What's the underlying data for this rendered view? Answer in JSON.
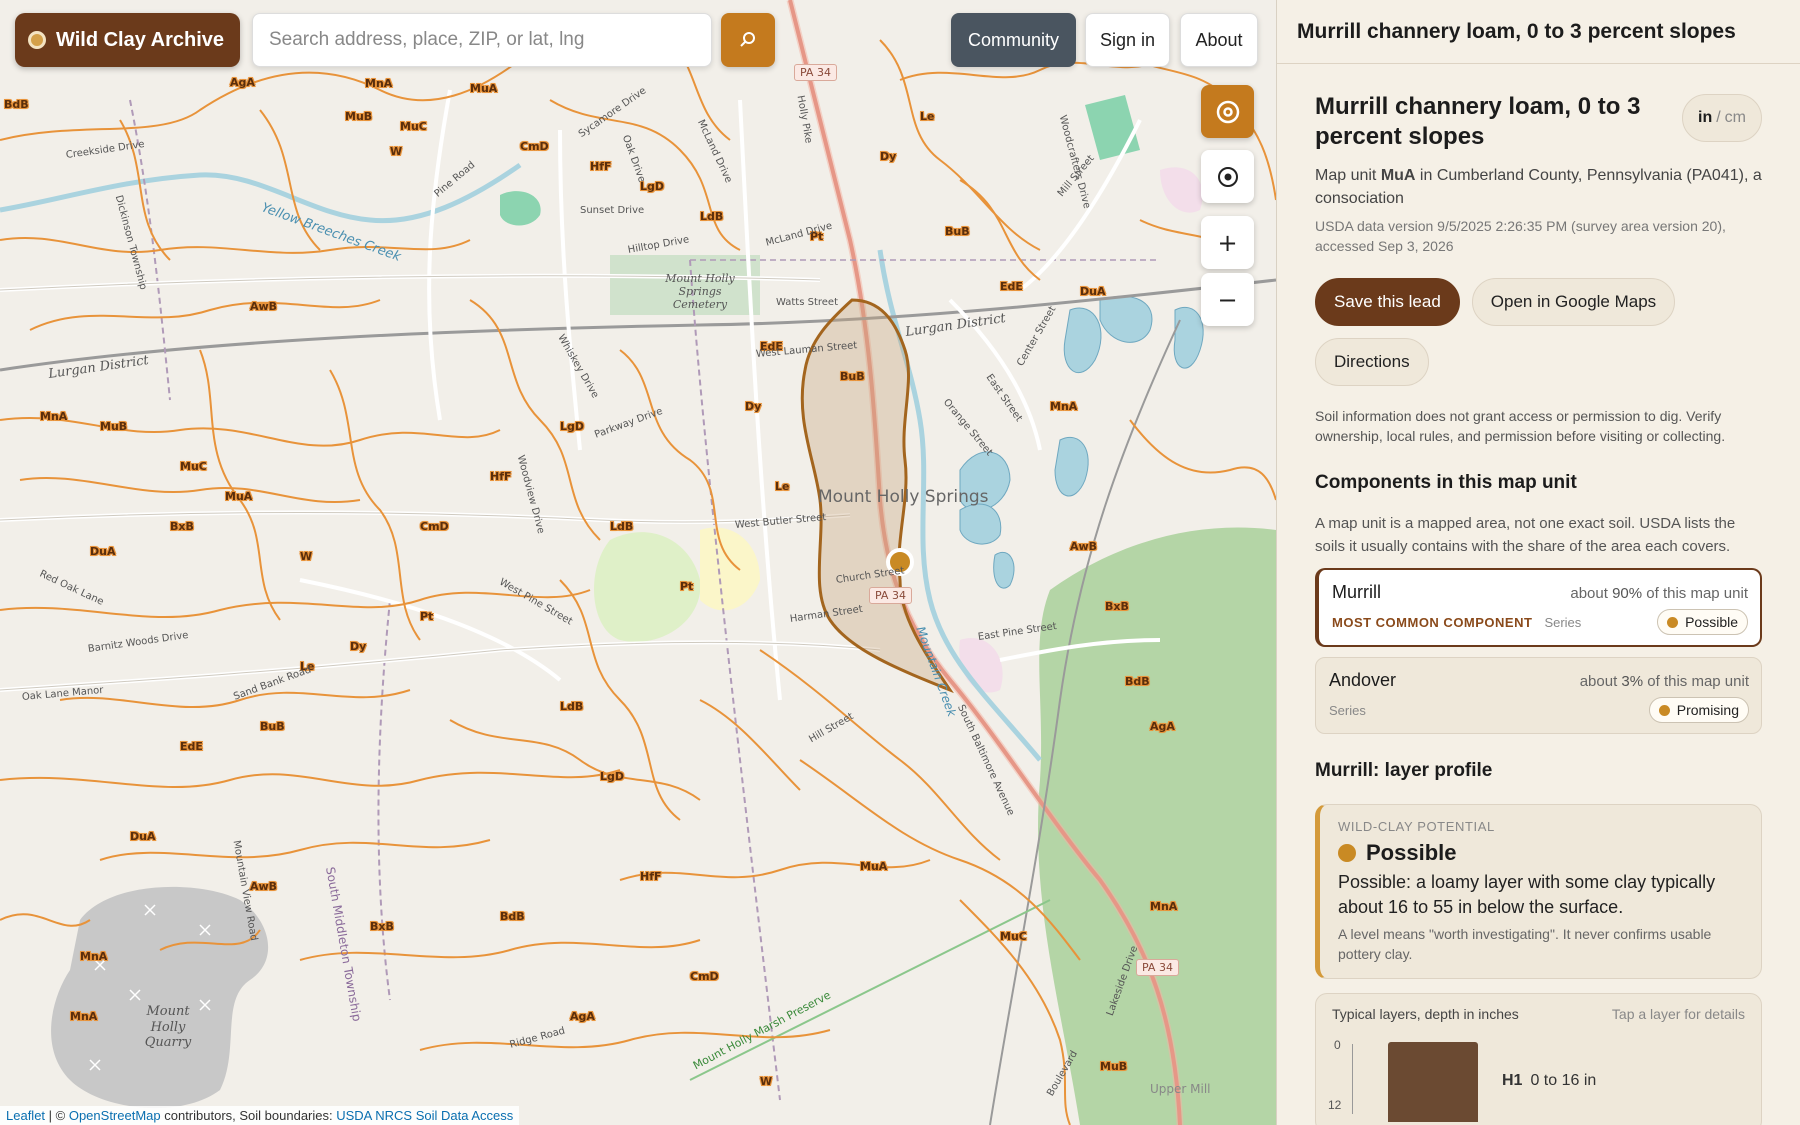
{
  "brand": {
    "name": "Wild Clay Archive"
  },
  "search": {
    "placeholder": "Search address, place, ZIP, or lat, lng",
    "button_icon": "search-icon"
  },
  "nav": {
    "community": "Community",
    "sign_in": "Sign in",
    "about": "About"
  },
  "map_controls": {
    "layers_icon": "target-icon",
    "locate_icon": "locate-icon",
    "zoom_in": "+",
    "zoom_out": "−"
  },
  "map_labels": {
    "places": [
      "Mount Holly Springs",
      "Mount Holly Springs Cemetery",
      "Mount Holly Quarry",
      "Lurgan District",
      "Lurgan District"
    ],
    "creeks": [
      "Yellow Breeches Creek",
      "Mountain Creek"
    ],
    "streets": [
      "Holly Pike",
      "Sycamore Drive",
      "Oak Drive",
      "McLand Drive",
      "Sunset Drive",
      "Hilltop Drive",
      "McLand Drive",
      "Watts Street",
      "West Lauman Street",
      "Pine Road",
      "Creekside Drive",
      "Dickinson Township",
      "Whiskey Drive",
      "Parkway Drive",
      "Woodview Drive",
      "West Butler Street",
      "Church Street",
      "Harman Street",
      "West Pine Street",
      "Barnitz Woods Drive",
      "Sand Bank Road",
      "Oak Lane Manor",
      "Red Oak Lane",
      "South Baltimore Avenue",
      "East Pine Street",
      "Orange Street",
      "East Street",
      "Center Street",
      "Mill Street",
      "Woodcrafters Drive",
      "South Middleton Township",
      "Ridge Road",
      "Mount Holly Marsh Preserve",
      "Hill Street",
      "Upper Mill",
      "Boulevard",
      "Lakeside Drive",
      "Mountain View Road"
    ],
    "route_shields": [
      "PA 34",
      "PA 34",
      "PA 34"
    ],
    "soil_units": [
      "BdB",
      "AgA",
      "MnA",
      "MuB",
      "MuC",
      "MuA",
      "W",
      "CmD",
      "HfF",
      "LgD",
      "LdB",
      "Pt",
      "Dy",
      "Le",
      "BuB",
      "EdE",
      "DuA",
      "MnA",
      "AwB",
      "BxB"
    ]
  },
  "attribution": {
    "leaflet": "Leaflet",
    "sep1": " | © ",
    "osm": "OpenStreetMap",
    "mid": " contributors, Soil boundaries: ",
    "usda": "USDA NRCS Soil Data Access"
  },
  "panel": {
    "header": "Murrill channery loam, 0 to 3 percent slopes",
    "title": "Murrill channery loam, 0 to 3 percent slopes",
    "unit_toggle": {
      "active": "in",
      "sep": "/",
      "inactive": "cm"
    },
    "subtitle_pre": "Map unit ",
    "map_unit": "MuA",
    "subtitle_post": " in Cumberland County, Pennsylvania (PA041), a consociation",
    "meta": "USDA data version 9/5/2025 2:26:35 PM (survey area version 20), accessed Sep 3, 2026",
    "actions": {
      "save": "Save this lead",
      "google_maps": "Open in Google Maps",
      "directions": "Directions"
    },
    "disclaimer": "Soil information does not grant access or permission to dig. Verify ownership, local rules, and permission before visiting or collecting.",
    "components_heading": "Components in this map unit",
    "components_intro": "A map unit is a mapped area, not one exact soil. USDA lists the soils it usually contains with the share of the area each covers.",
    "components": [
      {
        "name": "Murrill",
        "share_pre": "about ",
        "share": "90%",
        "share_post": " of this map unit",
        "most_common": "MOST COMMON COMPONENT",
        "kind": "Series",
        "level": "Possible"
      },
      {
        "name": "Andover",
        "share_pre": "about ",
        "share": "3%",
        "share_post": " of this map unit",
        "most_common": "",
        "kind": "Series",
        "level": "Promising"
      }
    ],
    "profile_heading": "Murrill: layer profile",
    "potential": {
      "eyebrow": "WILD-CLAY POTENTIAL",
      "level": "Possible",
      "text": "Possible: a loamy layer with some clay typically about 16 to 55 in below the surface.",
      "note": "A level means \"worth investigating\". It never confirms usable pottery clay."
    },
    "layers": {
      "title": "Typical layers, depth in inches",
      "hint": "Tap a layer for details",
      "axis": [
        "0",
        "12"
      ],
      "items": [
        {
          "name": "H1",
          "range": "0 to 16 in"
        }
      ]
    }
  },
  "colors": {
    "brand_brown": "#6b3a1b",
    "accent_orange": "#c47a1e",
    "soil_line": "#e8933a",
    "community_bg": "#4a5560",
    "panel_bg": "#f5f0e6"
  }
}
